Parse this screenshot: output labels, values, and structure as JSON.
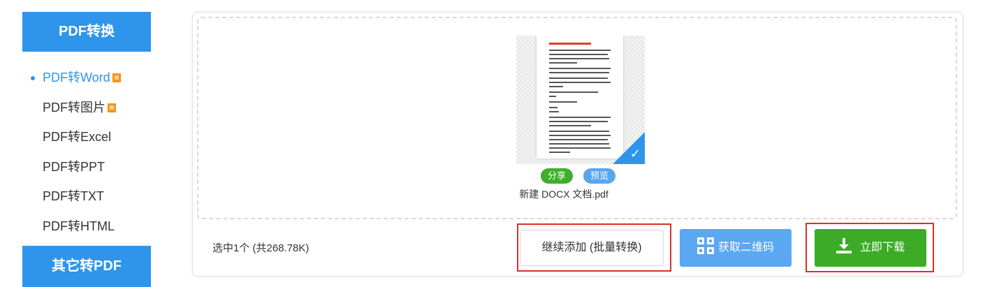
{
  "sidebar": {
    "section1_title": "PDF转换",
    "items": [
      {
        "label": "PDF转Word",
        "vip": true,
        "active": true
      },
      {
        "label": "PDF转图片",
        "vip": true,
        "active": false
      },
      {
        "label": "PDF转Excel",
        "vip": false,
        "active": false
      },
      {
        "label": "PDF转PPT",
        "vip": false,
        "active": false
      },
      {
        "label": "PDF转TXT",
        "vip": false,
        "active": false
      },
      {
        "label": "PDF转HTML",
        "vip": false,
        "active": false
      }
    ],
    "section2_title": "其它转PDF"
  },
  "file": {
    "share_label": "分享",
    "preview_label": "预览",
    "name": "新建 DOCX 文档.pdf",
    "selected": true
  },
  "footer": {
    "status": "选中1个 (共268.78K)",
    "add_label": "继续添加 (批量转换)",
    "qr_label": "获取二维码",
    "download_label": "立即下载"
  },
  "colors": {
    "accent": "#2e95ea",
    "download": "#3cab26",
    "qr": "#5aa7f2",
    "highlight": "#d93028"
  }
}
